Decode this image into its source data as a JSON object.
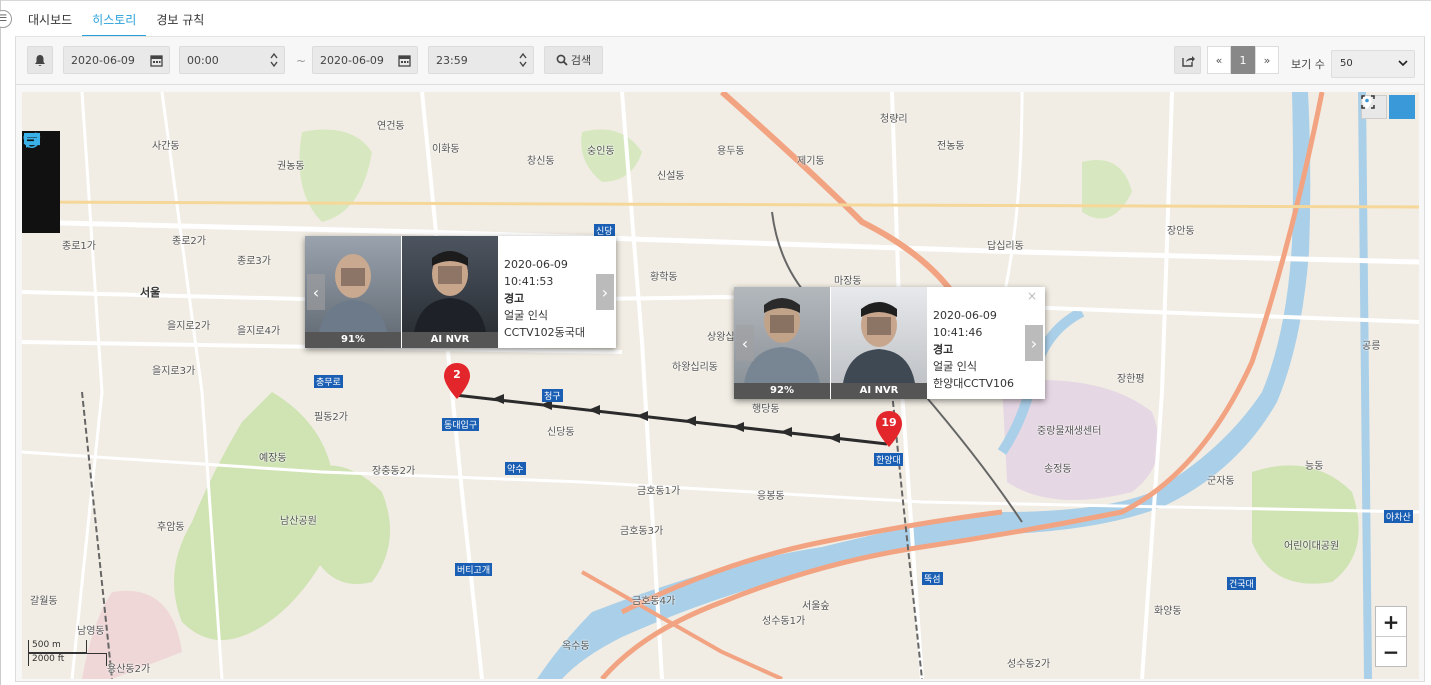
{
  "tabs": [
    {
      "label": "대시보드"
    },
    {
      "label": "히스토리"
    },
    {
      "label": "경보 규칙"
    }
  ],
  "toolbar": {
    "start_date": "2020-06-09",
    "start_time": "00:00",
    "separator": "~",
    "end_date": "2020-06-09",
    "end_time": "23:59",
    "search_label": "검색",
    "pagination": {
      "prev": "«",
      "current": "1",
      "next": "»"
    },
    "view_count_label": "보기 수",
    "view_count_value": "50"
  },
  "map": {
    "labels": {
      "seoul": "서울",
      "jongno1": "종로1가",
      "jongno2": "종로2가",
      "jongno3": "종로3가",
      "euljiro2": "을지로2가",
      "euljiro3": "을지로3가",
      "euljiro4": "을지로4가",
      "yeongundong": "연건동",
      "ihwadong": "이화동",
      "changsindong": "창신동",
      "sungindong": "숭인동",
      "sinseoldong": "신설동",
      "sagandong": "사간동",
      "gwonnongdong": "권농동",
      "hwanghakdong": "황학동",
      "majangdong": "마장동",
      "sangwangsimni": "상왕십리동",
      "hawangsimni": "하왕십리동",
      "sindangdong": "신당동",
      "yaksu": "약수",
      "geumho1": "금호동1가",
      "geumho3": "금호동3가",
      "geumho4": "금호동4가",
      "haengdangdong": "행당동",
      "eungbongdong": "응봉동",
      "hangangdae": "한양대",
      "songjeongdong": "송정동",
      "jungnang": "중랑물재생센터",
      "seongsu1": "성수동1가",
      "seongsu2": "성수동2가",
      "seoulforest": "서울숲",
      "hwayangdong": "화양동",
      "gunjadong": "군자동",
      "neungdong": "능동",
      "jangandong": "장안동",
      "dapsimni": "답십리동",
      "yongdudong": "용두동",
      "jegidong": "제기동",
      "cheongnyangni": "청량리",
      "jeonnongdong": "전농동",
      "yejangdong": "예장동",
      "namsanpark": "남산공원",
      "huamdong": "후암동",
      "galwoldong": "갈월동",
      "namyeongdong": "남영동",
      "yongsan2": "용산동2가",
      "jangchung2": "장충동2가",
      "pildong2": "필동2가",
      "dongdaeipgu": "동대입구",
      "chungmuro": "충무로",
      "sindang": "신당",
      "cheonggu": "청구",
      "beotigogae": "버티고개",
      "oksudong": "옥수동",
      "ttukseom": "뚝섬",
      "geonguk": "건국대",
      "childrenpark": "어린이대공원",
      "achasan": "아차산",
      "gongneung": "공릉",
      "jangpyeong": "장한평"
    },
    "scale": {
      "metric": "500 m",
      "imperial": "2000 ft"
    },
    "zoom": {
      "in": "+",
      "out": "−"
    }
  },
  "markers": [
    {
      "label": "2"
    },
    {
      "label": "19"
    }
  ],
  "popups": [
    {
      "timestamp": "2020-06-09 10:41:53",
      "level": "경고",
      "event": "얼굴 인식",
      "camera": "CCTV102동국대",
      "score": "91%",
      "source": "AI NVR"
    },
    {
      "timestamp": "2020-06-09 10:41:46",
      "level": "경고",
      "event": "얼굴 인식",
      "camera": "한양대CCTV106",
      "score": "92%",
      "source": "AI NVR",
      "close": "×"
    }
  ],
  "colors": {
    "accent": "#29a0d8",
    "marker": "#e3262b",
    "track": "#2b2b2b"
  },
  "icons": [
    "bell-icon",
    "calendar-icon",
    "updown-icon",
    "search-icon",
    "export-icon",
    "chevron-down-icon",
    "route-icon",
    "comment-icon",
    "swap-icon",
    "focus-icon",
    "location-icon",
    "menu-icon"
  ]
}
